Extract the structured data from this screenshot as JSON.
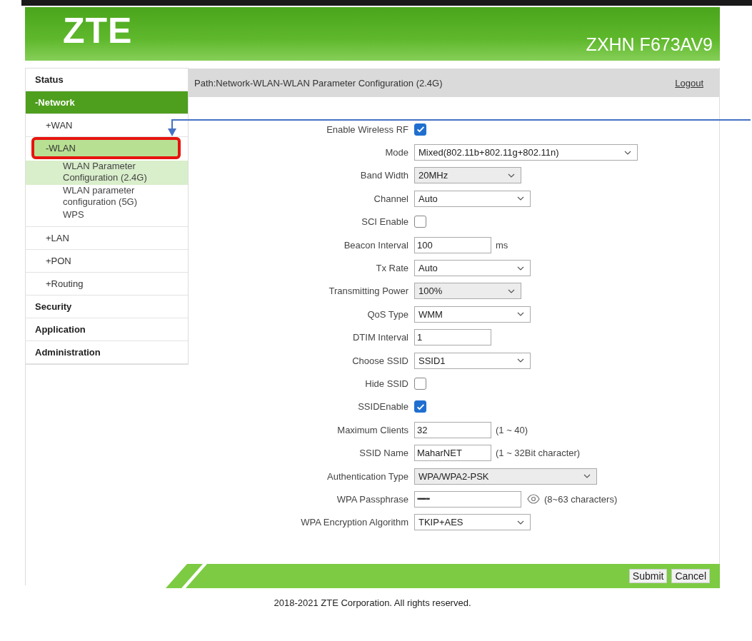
{
  "header": {
    "logo": "ZTE",
    "model": "ZXHN F673AV9"
  },
  "sidebar": {
    "items": [
      {
        "label": "Status",
        "selected": false
      },
      {
        "label": "-Network",
        "selected": true,
        "children": [
          {
            "label": "+WAN",
            "selected": false,
            "annotated": false
          },
          {
            "label": "-WLAN",
            "selected": true,
            "annotated": true,
            "children": [
              {
                "label": "WLAN Parameter Configuration (2.4G)",
                "selected": true
              },
              {
                "label": "WLAN parameter configuration (5G)",
                "selected": false
              },
              {
                "label": "WPS",
                "selected": false
              }
            ]
          },
          {
            "label": "+LAN",
            "selected": false,
            "annotated": false
          },
          {
            "label": "+PON",
            "selected": false,
            "annotated": false
          },
          {
            "label": "+Routing",
            "selected": false,
            "annotated": false
          }
        ]
      },
      {
        "label": "Security",
        "selected": false
      },
      {
        "label": "Application",
        "selected": false
      },
      {
        "label": "Administration",
        "selected": false
      }
    ]
  },
  "path": "Path:Network-WLAN-WLAN Parameter Configuration (2.4G)",
  "logout": "Logout",
  "fields": [
    {
      "kind": "checkbox",
      "label": "Enable Wireless RF",
      "checked": true
    },
    {
      "kind": "select",
      "label": "Mode",
      "value": "Mixed(802.11b+802.11g+802.11n)",
      "disabled": false
    },
    {
      "kind": "select",
      "label": "Band Width",
      "value": "20MHz",
      "disabled": true
    },
    {
      "kind": "select",
      "label": "Channel",
      "value": "Auto",
      "disabled": false
    },
    {
      "kind": "checkbox",
      "label": "SCI Enable",
      "checked": false
    },
    {
      "kind": "text",
      "label": "Beacon Interval",
      "value": "100",
      "hint": "ms"
    },
    {
      "kind": "select",
      "label": "Tx Rate",
      "value": "Auto",
      "disabled": false
    },
    {
      "kind": "select",
      "label": "Transmitting Power",
      "value": "100%",
      "disabled": true
    },
    {
      "kind": "select",
      "label": "QoS Type",
      "value": "WMM",
      "disabled": false
    },
    {
      "kind": "text",
      "label": "DTIM Interval",
      "value": "1"
    },
    {
      "kind": "select",
      "label": "Choose SSID",
      "value": "SSID1",
      "disabled": false
    },
    {
      "kind": "checkbox",
      "label": "Hide SSID",
      "checked": false
    },
    {
      "kind": "checkbox",
      "label": "SSIDEnable",
      "checked": true
    },
    {
      "kind": "text",
      "label": "Maximum Clients",
      "value": "32",
      "hint": "(1 ~ 40)"
    },
    {
      "kind": "text",
      "label": "SSID Name",
      "value": "MaharNET",
      "hint": "(1 ~ 32Bit character)"
    },
    {
      "kind": "select",
      "label": "Authentication Type",
      "value": "WPA/WPA2-PSK",
      "disabled": true
    },
    {
      "kind": "password",
      "label": "WPA Passphrase",
      "value": "••••••••",
      "hint": "(8~63 characters)"
    },
    {
      "kind": "select",
      "label": "WPA Encryption Algorithm",
      "value": "TKIP+AES",
      "disabled": false
    }
  ],
  "buttons": [
    "Submit",
    "Cancel"
  ],
  "copyright": "2018-2021 ZTE Corporation. All rights reserved."
}
